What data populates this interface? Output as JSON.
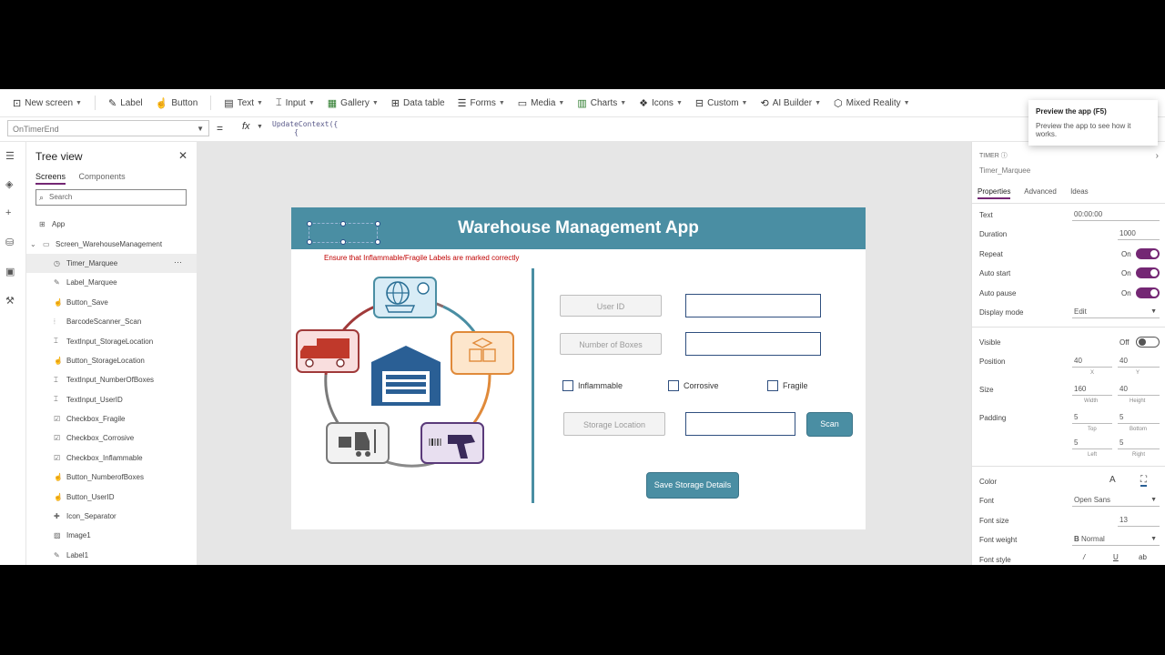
{
  "toolbar": {
    "items": [
      {
        "label": "New screen",
        "icon": "new-screen-icon"
      },
      {
        "label": "Label",
        "icon": "label-icon"
      },
      {
        "label": "Button",
        "icon": "button-icon"
      },
      {
        "label": "Text",
        "icon": "text-icon"
      },
      {
        "label": "Input",
        "icon": "input-icon"
      },
      {
        "label": "Gallery",
        "icon": "gallery-icon"
      },
      {
        "label": "Data table",
        "icon": "data-table-icon"
      },
      {
        "label": "Forms",
        "icon": "forms-icon"
      },
      {
        "label": "Media",
        "icon": "media-icon"
      },
      {
        "label": "Charts",
        "icon": "charts-icon"
      },
      {
        "label": "Icons",
        "icon": "icons-icon"
      },
      {
        "label": "Custom",
        "icon": "custom-icon"
      },
      {
        "label": "AI Builder",
        "icon": "ai-builder-icon"
      },
      {
        "label": "Mixed Reality",
        "icon": "mixed-reality-icon"
      }
    ]
  },
  "formula_bar": {
    "property": "OnTimerEnd",
    "formula_line1": "UpdateContext({",
    "formula_line2": "{"
  },
  "tooltip": {
    "title": "Preview the app (F5)",
    "text": "Preview the app to see how it works."
  },
  "tree_view": {
    "title": "Tree view",
    "tabs": [
      "Screens",
      "Components"
    ],
    "search_placeholder": "Search",
    "app_label": "App",
    "screen_label": "Screen_WarehouseManagement",
    "items": [
      "Timer_Marquee",
      "Label_Marquee",
      "Button_Save",
      "BarcodeScanner_Scan",
      "TextInput_StorageLocation",
      "Button_StorageLocation",
      "TextInput_NumberOfBoxes",
      "TextInput_UserID",
      "Checkbox_Fragile",
      "Checkbox_Corrosive",
      "Checkbox_Inflammable",
      "Button_NumberofBoxes",
      "Button_UserID",
      "Icon_Separator",
      "Image1",
      "Label1"
    ],
    "selected_index": 0
  },
  "screen": {
    "title": "Warehouse Management App",
    "warning": "Ensure that Inflammable/Fragile Labels are marked correctly",
    "user_id_label": "User ID",
    "boxes_label": "Number of Boxes",
    "checkboxes": [
      "Inflammable",
      "Corrosive",
      "Fragile"
    ],
    "storage_label": "Storage Location",
    "scan_button": "Scan",
    "save_button": "Save Storage Details",
    "header_color": "#4a8ea3"
  },
  "properties": {
    "type": "TIMER",
    "name": "Timer_Marquee",
    "tabs": [
      "Properties",
      "Advanced",
      "Ideas"
    ],
    "text_label": "Text",
    "text_value": "00:00:00",
    "duration_label": "Duration",
    "duration_value": "1000",
    "repeat_label": "Repeat",
    "repeat_value": "On",
    "autostart_label": "Auto start",
    "autostart_value": "On",
    "autopause_label": "Auto pause",
    "autopause_value": "On",
    "display_label": "Display mode",
    "display_value": "Edit",
    "visible_label": "Visible",
    "visible_value": "Off",
    "position_label": "Position",
    "pos_x": "40",
    "pos_y": "40",
    "x_label": "X",
    "y_label": "Y",
    "size_label": "Size",
    "width_value": "160",
    "height_value": "40",
    "width_label": "Width",
    "height_label": "Height",
    "padding_label": "Padding",
    "pad_top": "5",
    "pad_bottom": "5",
    "pad_left": "5",
    "pad_right": "5",
    "top_label": "Top",
    "bottom_label": "Bottom",
    "left_label": "Left",
    "right_label": "Right",
    "color_label": "Color",
    "font_label": "Font",
    "font_value": "Open Sans",
    "fontsize_label": "Font size",
    "fontsize_value": "13",
    "fontweight_label": "Font weight",
    "fontweight_value": "Normal",
    "fontstyle_label": "Font style"
  }
}
